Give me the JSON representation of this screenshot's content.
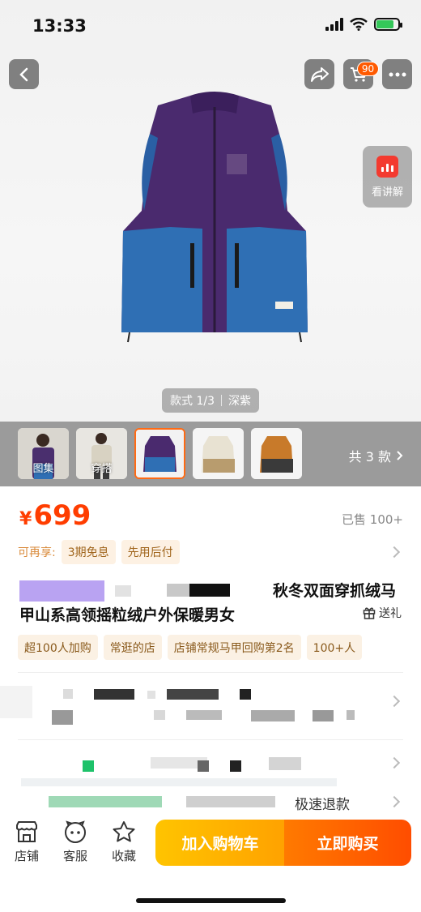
{
  "status_bar": {
    "time": "13:33"
  },
  "top_nav": {
    "cart_count": "90"
  },
  "hero": {
    "explain_label": "看讲解",
    "style_pill": {
      "index": "款式 1/3",
      "color": "深紫"
    }
  },
  "thumbnails": {
    "items": [
      {
        "label": "图集"
      },
      {
        "label": "穿搭"
      },
      {
        "label": ""
      },
      {
        "label": ""
      },
      {
        "label": ""
      }
    ],
    "count_label": "共 3 款"
  },
  "price": {
    "symbol": "¥",
    "value": "699",
    "sold": "已售 100+"
  },
  "enjoy": {
    "label": "可再享:",
    "tags": [
      "3期免息",
      "先用后付"
    ]
  },
  "title": {
    "line1_visible": "秋冬双面穿抓绒马",
    "line2": "甲山系高领摇粒绒户外保暖男女",
    "gift": "送礼"
  },
  "tags": [
    "超100人加购",
    "常逛的店",
    "店铺常规马甲回购第2名",
    "100+人"
  ],
  "service_row": {
    "visible_text": "极速退款"
  },
  "bottom_bar": {
    "shop_label": "店铺",
    "service_label": "客服",
    "favorite_label": "收藏",
    "add_to_cart": "加入购物车",
    "buy_now": "立即购买"
  },
  "colors": {
    "accent_orange": "#ff4d00",
    "price_red": "#ff3d00",
    "cart_yellow": "#ffb000",
    "tag_bg": "#fbf1e4"
  },
  "icons": [
    "back-icon",
    "share-icon",
    "cart-icon",
    "more-icon",
    "chart-icon",
    "shop-icon",
    "service-icon",
    "star-icon",
    "gift-icon",
    "chevron-right-icon"
  ]
}
